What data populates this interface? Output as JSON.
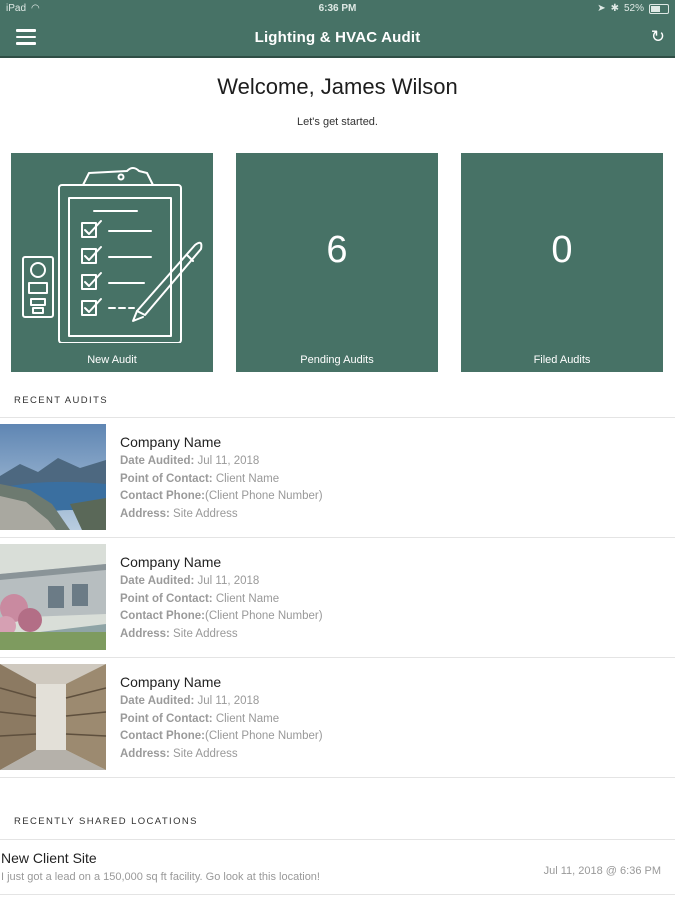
{
  "status_bar": {
    "carrier": "iPad",
    "time": "6:36 PM",
    "battery": "52%"
  },
  "header": {
    "title": "Lighting & HVAC Audit",
    "menu_icon": "hamburger-icon",
    "refresh_icon": "refresh-icon"
  },
  "welcome": {
    "heading": "Welcome, James Wilson",
    "subtitle": "Let's get started."
  },
  "tiles": [
    {
      "label": "New Audit",
      "icon": "clipboard-checklist-icon"
    },
    {
      "label": "Pending Audits",
      "count": "6"
    },
    {
      "label": "Filed Audits",
      "count": "0"
    }
  ],
  "recent_audits": {
    "section_label": "RECENT AUDITS",
    "items": [
      {
        "company": "Company Name",
        "date_label": "Date Audited:",
        "date_value": " Jul 11, 2018",
        "contact_label": "Point of Contact:",
        "contact_value": " Client Name",
        "phone_label": "Contact Phone:",
        "phone_value": "(Client Phone Number)",
        "address_label": "Address:",
        "address_value": " Site Address"
      },
      {
        "company": "Company Name",
        "date_label": "Date Audited:",
        "date_value": " Jul 11, 2018",
        "contact_label": "Point of Contact:",
        "contact_value": " Client Name",
        "phone_label": "Contact Phone:",
        "phone_value": "(Client Phone Number)",
        "address_label": "Address:",
        "address_value": " Site Address"
      },
      {
        "company": "Company Name",
        "date_label": "Date Audited:",
        "date_value": " Jul 11, 2018",
        "contact_label": "Point of Contact:",
        "contact_value": " Client Name",
        "phone_label": "Contact Phone:",
        "phone_value": "(Client Phone Number)",
        "address_label": "Address:",
        "address_value": " Site Address"
      }
    ]
  },
  "shared_locations": {
    "section_label": "RECENTLY SHARED LOCATIONS",
    "items": [
      {
        "name": "New Client Site",
        "description": "I just got a lead on a 150,000 sq ft facility. Go look at this location!",
        "date": "Jul 11, 2018 @ 6:36 PM"
      }
    ]
  },
  "colors": {
    "brand": "#477266",
    "header_border": "#2f4e45",
    "muted_text": "#999999"
  }
}
